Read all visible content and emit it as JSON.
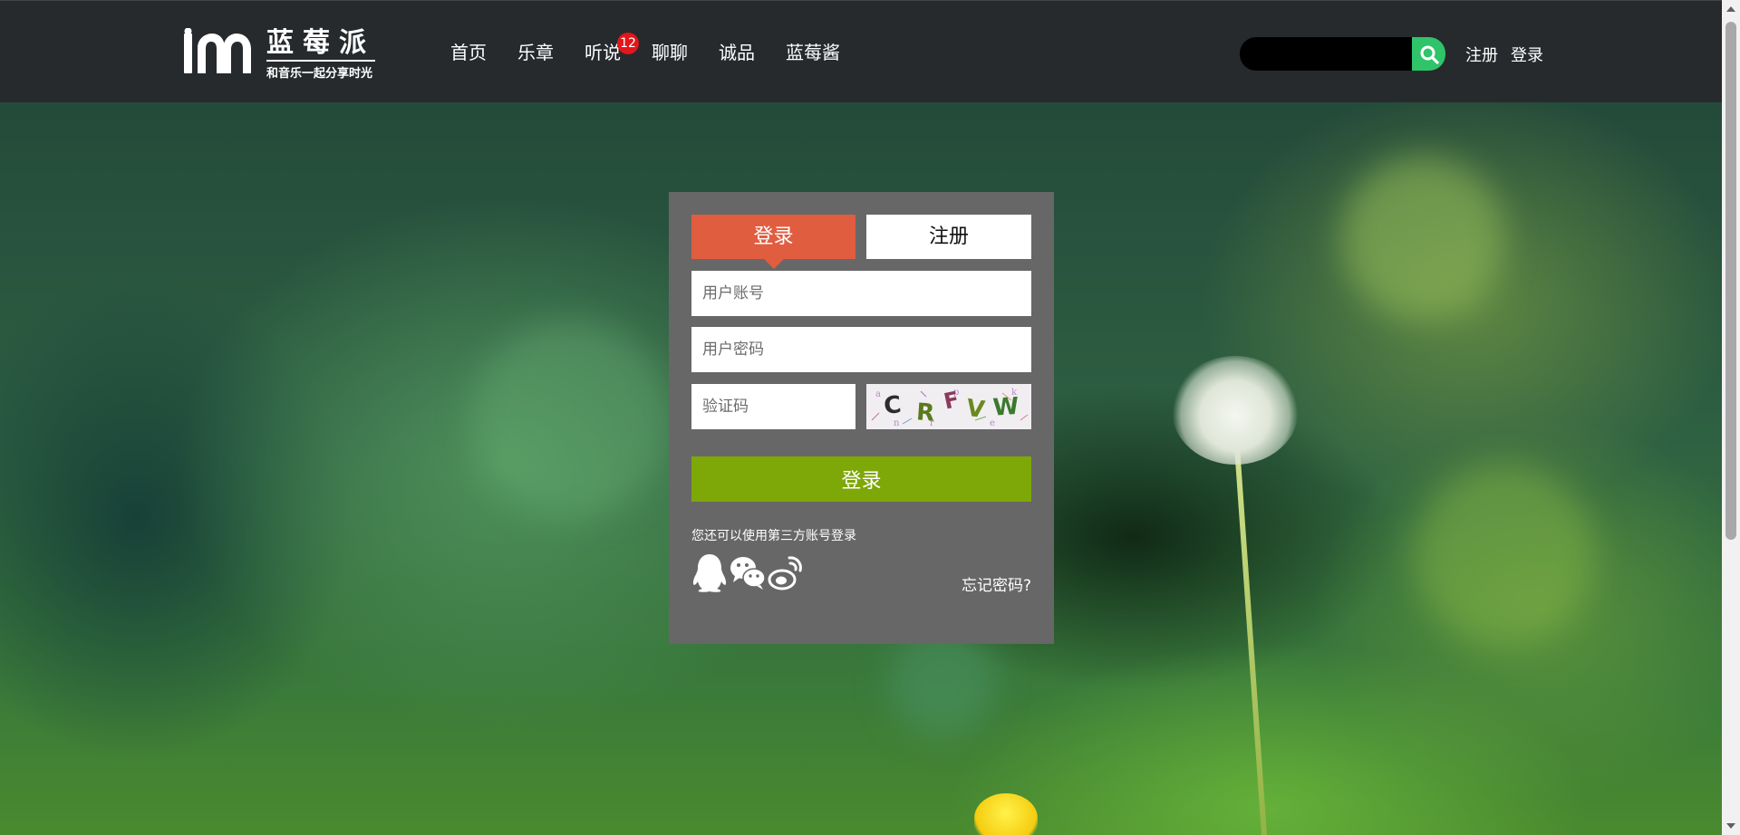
{
  "brand": {
    "title": "蓝莓派",
    "slogan": "和音乐一起分享时光"
  },
  "nav": {
    "items": [
      {
        "label": "首页"
      },
      {
        "label": "乐章"
      },
      {
        "label": "听说",
        "badge": "12"
      },
      {
        "label": "聊聊"
      },
      {
        "label": "诚品"
      },
      {
        "label": "蓝莓酱"
      }
    ]
  },
  "search": {
    "value": "",
    "icon": "search-icon"
  },
  "top_links": {
    "register": "注册",
    "login": "登录"
  },
  "login_panel": {
    "tab_login": "登录",
    "tab_register": "注册",
    "username_placeholder": "用户账号",
    "password_placeholder": "用户密码",
    "captcha_placeholder": "验证码",
    "captcha_text": "CRFVW",
    "submit_label": "登录",
    "third_party_text": "您还可以使用第三方账号登录",
    "social_icons": [
      "qq-icon",
      "wechat-icon",
      "weibo-icon"
    ],
    "forgot_label": "忘记密码?"
  },
  "colors": {
    "header_bg": "#262a2d",
    "panel_bg": "#676767",
    "tab_active": "#e05d40",
    "submit_green": "#7ea708",
    "search_green": "#2fc46a",
    "badge_red": "#e2161b"
  }
}
